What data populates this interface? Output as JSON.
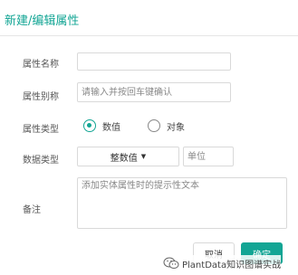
{
  "dialog": {
    "title": "新建/编辑属性"
  },
  "form": {
    "name": {
      "label": "属性名称",
      "value": "",
      "placeholder": ""
    },
    "alias": {
      "label": "属性别称",
      "value": "",
      "placeholder": "请输入并按回车键确认"
    },
    "type": {
      "label": "属性类型",
      "options": [
        {
          "label": "数值",
          "selected": true
        },
        {
          "label": "对象",
          "selected": false
        }
      ]
    },
    "data_type": {
      "label": "数据类型",
      "selected": "整数值",
      "unit_placeholder": "单位"
    },
    "remark": {
      "label": "备注",
      "placeholder": "添加实体属性时的提示性文本"
    }
  },
  "footer": {
    "cancel_label": "取消",
    "ok_label": "确定"
  },
  "watermark": {
    "text": "PlantData知识图谱实战",
    "icon": "wechat-icon"
  },
  "colors": {
    "accent": "#12a594",
    "border": "#d9d9d9"
  }
}
